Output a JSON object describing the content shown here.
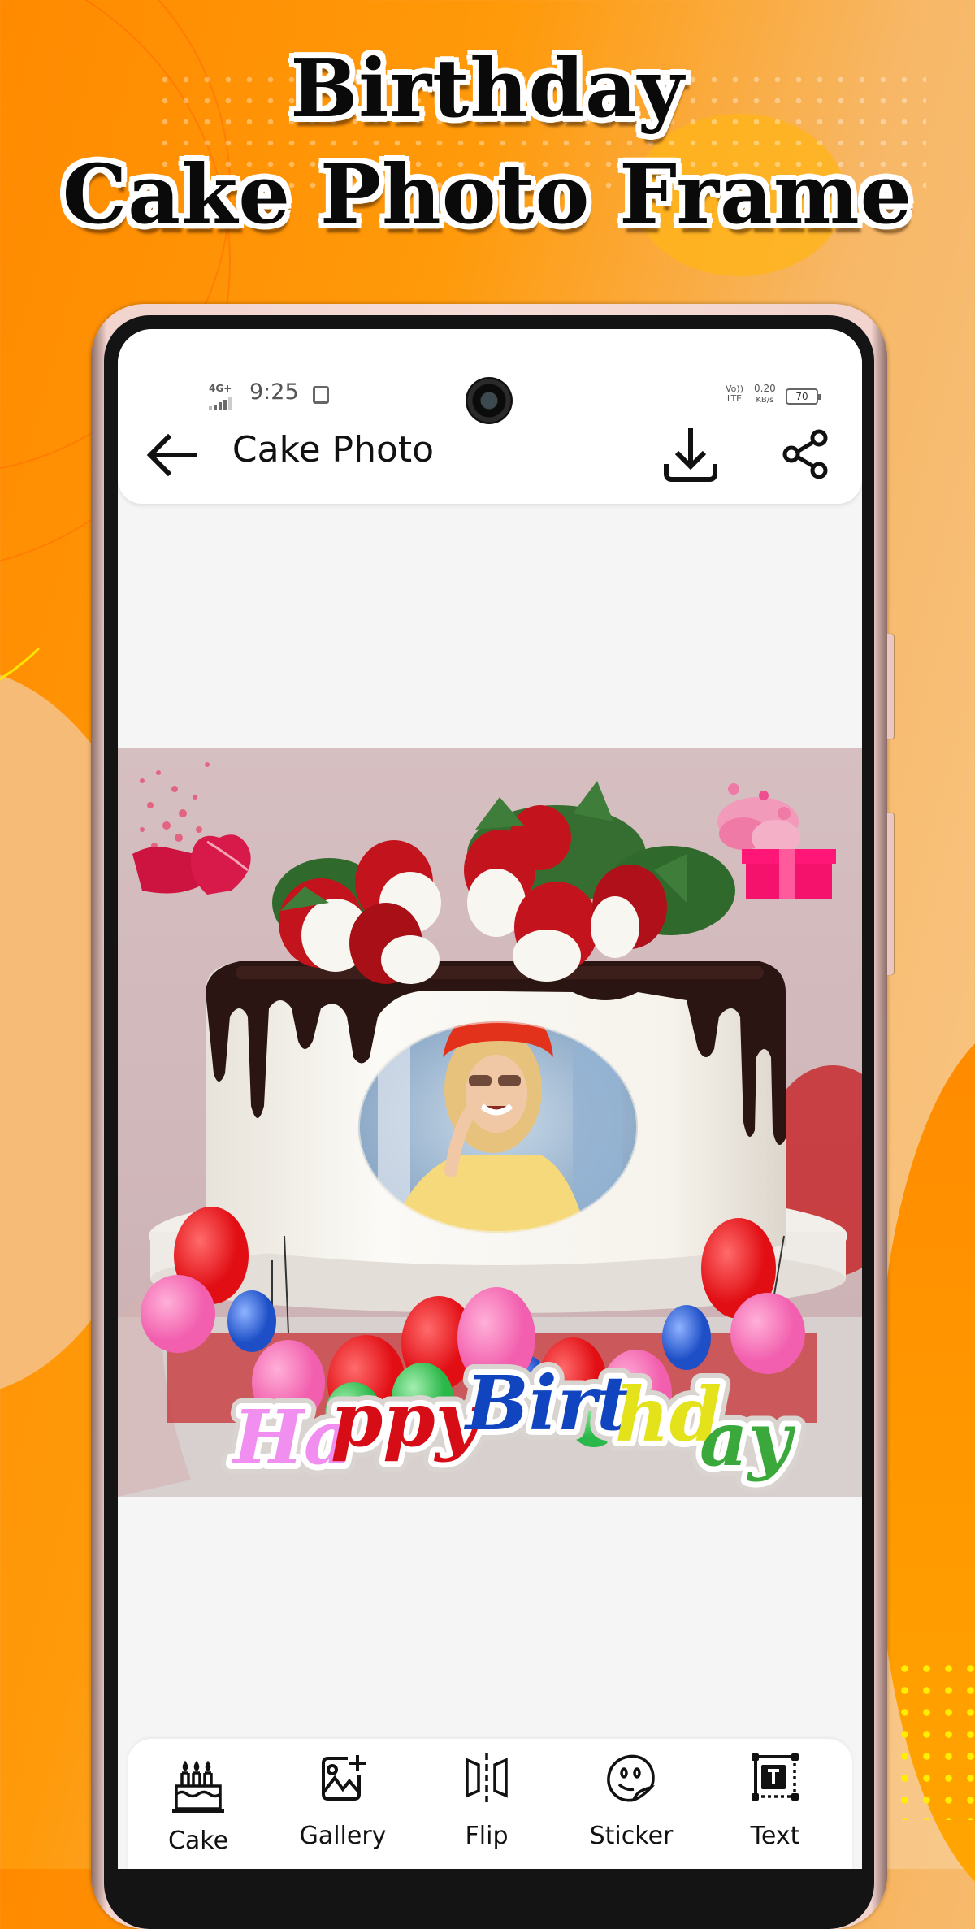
{
  "promo": {
    "headline_line1": "Birthday",
    "headline_line2": "Cake Photo Frame"
  },
  "status_bar": {
    "network": "4G+",
    "time": "9:25",
    "volte": "Vo)) LTE",
    "speed_value": "0.20",
    "speed_unit": "KB/s",
    "battery": "70"
  },
  "app_bar": {
    "back_icon": "arrow-left",
    "title": "Cake Photo",
    "download_icon": "download",
    "share_icon": "share"
  },
  "editor": {
    "frame_name": "Happy Birthday chocolate drip cake frame",
    "sticker_text": "Happy Birthday",
    "colors": {
      "backdrop": "#d4bcbf",
      "chocolate": "#2a1512",
      "cream": "#f8f5ee",
      "strawberry": "#c3141d"
    }
  },
  "toolbar": {
    "items": [
      {
        "label": "Cake",
        "icon": "cake-icon"
      },
      {
        "label": "Gallery",
        "icon": "gallery-add-icon"
      },
      {
        "label": "Flip",
        "icon": "flip-icon"
      },
      {
        "label": "Sticker",
        "icon": "sticker-icon"
      },
      {
        "label": "Text",
        "icon": "text-box-icon"
      }
    ]
  }
}
